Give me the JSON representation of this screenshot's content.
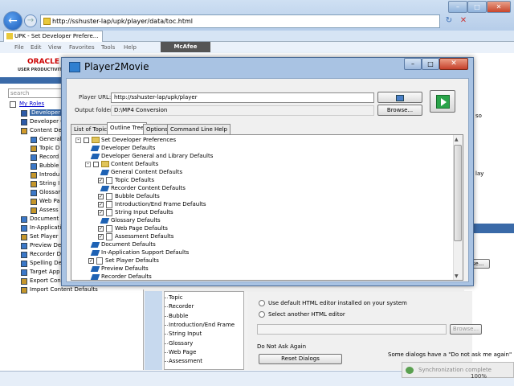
{
  "browser": {
    "url": "http://sshuster-lap/upk/player/data/toc.html",
    "tab_title": "UPK - Set Developer Prefere...",
    "menu": [
      "File",
      "Edit",
      "View",
      "Favorites",
      "Tools",
      "Help"
    ],
    "addon": "McAfee",
    "zoom": "100%"
  },
  "page": {
    "brand": "ORACLE",
    "brand_sub": "USER PRODUCTIVITY KIT",
    "search_placeholder": "search",
    "my_roles": "My Roles",
    "tree": [
      "Developer",
      "Developer G",
      "Content De",
      "General",
      "Topic D",
      "Record",
      "Bubble",
      "Introdu",
      "String I",
      "Glossar",
      "Web Pa",
      "Assess",
      "Document",
      "In-Applicatio",
      "Set Player",
      "Preview De",
      "Recorder D",
      "Spelling De",
      "Target App",
      "Export Con",
      "Import Content Defaults"
    ],
    "right_fragments": [
      "so",
      "lay",
      "se..."
    ],
    "sublist": [
      "Topic",
      "Recorder",
      "Bubble",
      "Introduction/End Frame",
      "String Input",
      "Glossary",
      "Web Page",
      "Assessment"
    ],
    "radio1": "Use default HTML editor installed on your system",
    "radio2": "Select another HTML editor",
    "browse_disabled": "Browse...",
    "dnaa_label": "Do Not Ask Again",
    "reset_button": "Reset Dialogs",
    "dnaa_text": "Some dialogs have a \"Do not ask me again\""
  },
  "toast": "Synchronization complete",
  "dialog": {
    "title": "Player2Movie",
    "player_url_label": "Player URL:",
    "player_url_value": "http://sshuster-lap/upk/player",
    "output_folder_label": "Output folder:",
    "output_folder_value": "D:\\MP4 Conversion",
    "browse_label": "Browse...",
    "tabs": [
      "List of Topics",
      "Outline Tree",
      "Options",
      "Command Line Help"
    ],
    "selected_tab": "Outline Tree",
    "tree": [
      {
        "label": "Set Developer Preferences",
        "level": 0,
        "kind": "root",
        "expand": "-"
      },
      {
        "label": "Developer Defaults",
        "level": 1,
        "kind": "gem"
      },
      {
        "label": "Developer General and Library Defaults",
        "level": 1,
        "kind": "gem"
      },
      {
        "label": "Content Defaults",
        "level": 1,
        "kind": "folder",
        "expand": "-"
      },
      {
        "label": "General Content Defaults",
        "level": 2,
        "kind": "gem"
      },
      {
        "label": "Topic Defaults",
        "level": 2,
        "kind": "checked"
      },
      {
        "label": "Recorder Content Defaults",
        "level": 2,
        "kind": "gem"
      },
      {
        "label": "Bubble Defaults",
        "level": 2,
        "kind": "checked"
      },
      {
        "label": "Introduction/End Frame Defaults",
        "level": 2,
        "kind": "checked"
      },
      {
        "label": "String Input Defaults",
        "level": 2,
        "kind": "checked"
      },
      {
        "label": "Glossary Defaults",
        "level": 2,
        "kind": "gem"
      },
      {
        "label": "Web Page Defaults",
        "level": 2,
        "kind": "checked"
      },
      {
        "label": "Assessment Defaults",
        "level": 2,
        "kind": "checked"
      },
      {
        "label": "Document Defaults",
        "level": 1,
        "kind": "gem"
      },
      {
        "label": "In-Application Support Defaults",
        "level": 1,
        "kind": "gem"
      },
      {
        "label": "Set Player Defaults",
        "level": 1,
        "kind": "checked"
      },
      {
        "label": "Preview Defaults",
        "level": 1,
        "kind": "gem"
      },
      {
        "label": "Recorder Defaults",
        "level": 1,
        "kind": "gem"
      }
    ]
  }
}
